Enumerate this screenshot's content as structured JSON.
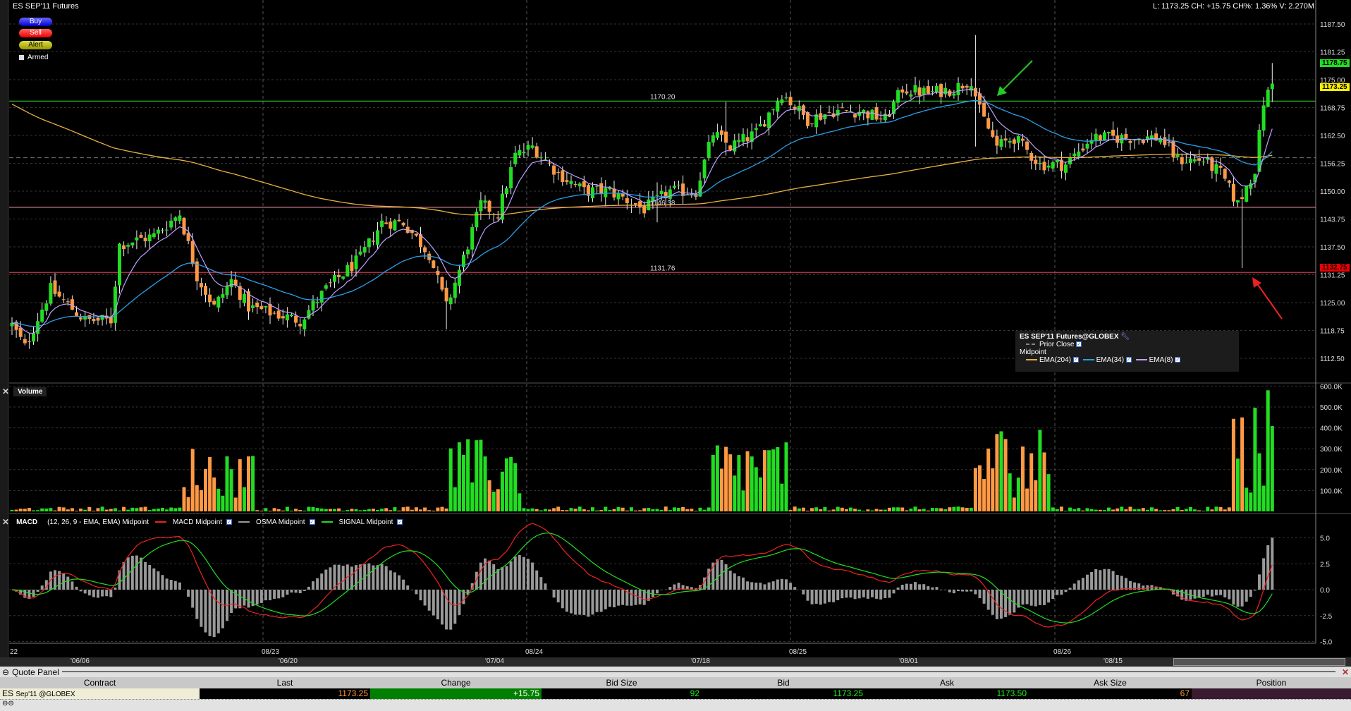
{
  "header": {
    "symbol": "ES SEP'11 Futures",
    "stats": "L: 1173.25 CH: +15.75 CH%: 1.36% V: 2.270M"
  },
  "buttons": {
    "buy": "Buy",
    "sell": "Sell",
    "alert": "Alert",
    "armed": "Armed"
  },
  "price_tags": {
    "high": "1178.75",
    "last": "1173.25",
    "low": "1132.75"
  },
  "hlines": [
    {
      "label": "1170.20",
      "value": 1170.2,
      "color": "#33cc33"
    },
    {
      "label": "1146.38",
      "value": 1146.38,
      "color": "#cc7788"
    },
    {
      "label": "1131.76",
      "value": 1131.76,
      "color": "#cc3344"
    }
  ],
  "prior_close": 1157.5,
  "legend": {
    "title": "ES SEP'11 Futures@GLOBEX",
    "prior_close": "Prior Close",
    "midpoint": "Midpoint",
    "ema204": "EMA(204)",
    "ema34": "EMA(34)",
    "ema8": "EMA(8)"
  },
  "colors": {
    "up": "#22dd22",
    "down": "#ff9944",
    "ema204": "#e8b040",
    "ema34": "#2a9fe8",
    "ema8": "#c0a0ff",
    "macd": "#ee2222",
    "signal": "#22dd22",
    "osma": "#999999"
  },
  "volume_panel": {
    "title": "Volume"
  },
  "macd_panel": {
    "title": "MACD",
    "params": "(12, 26, 9 - EMA, EMA) Midpoint",
    "macd": "MACD Midpoint",
    "osma": "OSMA Midpoint",
    "signal": "SIGNAL Midpoint"
  },
  "chart_data": {
    "type": "candlestick",
    "price_axis": {
      "ticks": [
        "1187.50",
        "1181.25",
        "1175.00",
        "1168.75",
        "1162.50",
        "1156.25",
        "1150.00",
        "1143.75",
        "1137.50",
        "1131.25",
        "1125.00",
        "1118.75",
        "1112.50"
      ],
      "range": [
        1106,
        1193
      ]
    },
    "volume_axis": {
      "ticks": [
        "600.0K",
        "500.0K",
        "400.0K",
        "300.0K",
        "200.0K",
        "100.0K"
      ],
      "range": [
        0,
        620
      ]
    },
    "macd_axis": {
      "ticks": [
        "5.0",
        "2.5",
        "0.0",
        "-2.5",
        "-5.0"
      ],
      "range": [
        -5,
        5
      ]
    },
    "date_labels": [
      "22",
      "08/23",
      "08/24",
      "08/25",
      "08/26"
    ],
    "scroll_labels": [
      "'06/06",
      "'06/20",
      "'07/04",
      "'07/18",
      "'08/01",
      "'08/15"
    ],
    "bars": 294,
    "anchors": [
      [
        0,
        1120
      ],
      [
        3,
        1115
      ],
      [
        9,
        1128
      ],
      [
        17,
        1121
      ],
      [
        23,
        1121
      ],
      [
        25,
        1138
      ],
      [
        33,
        1140
      ],
      [
        39,
        1145
      ],
      [
        43,
        1131
      ],
      [
        47,
        1124
      ],
      [
        51,
        1130
      ],
      [
        55,
        1124
      ],
      [
        63,
        1122
      ],
      [
        67,
        1121
      ],
      [
        73,
        1128
      ],
      [
        81,
        1135
      ],
      [
        86,
        1143
      ],
      [
        91,
        1143
      ],
      [
        97,
        1136
      ],
      [
        101,
        1124
      ],
      [
        105,
        1135
      ],
      [
        109,
        1147
      ],
      [
        113,
        1145
      ],
      [
        117,
        1158
      ],
      [
        121,
        1160
      ],
      [
        127,
        1154
      ],
      [
        133,
        1150
      ],
      [
        139,
        1150
      ],
      [
        147,
        1146
      ],
      [
        153,
        1150
      ],
      [
        159,
        1150
      ],
      [
        163,
        1163
      ],
      [
        167,
        1160
      ],
      [
        173,
        1163
      ],
      [
        179,
        1172
      ],
      [
        185,
        1166
      ],
      [
        191,
        1168
      ],
      [
        197,
        1168
      ],
      [
        203,
        1166
      ],
      [
        207,
        1173
      ],
      [
        213,
        1172
      ],
      [
        219,
        1173
      ],
      [
        223,
        1175
      ],
      [
        225,
        1168
      ],
      [
        229,
        1160
      ],
      [
        233,
        1162
      ],
      [
        239,
        1156
      ],
      [
        245,
        1156
      ],
      [
        251,
        1162
      ],
      [
        257,
        1162
      ],
      [
        263,
        1162
      ],
      [
        267,
        1162
      ],
      [
        271,
        1157
      ],
      [
        277,
        1157
      ],
      [
        281,
        1154
      ],
      [
        285,
        1147
      ],
      [
        289,
        1155
      ],
      [
        291,
        1170
      ],
      [
        293,
        1174
      ]
    ],
    "wicks": [
      [
        224,
        1185,
        1160
      ],
      [
        286,
        1150,
        1132.75
      ],
      [
        101,
        1130,
        1119
      ],
      [
        150,
        1152,
        1143
      ],
      [
        166,
        1170,
        1158
      ],
      [
        293,
        1178.75,
        1170
      ]
    ],
    "ema204_seed": 1170,
    "volume_clusters": [
      [
        40,
        56,
        320
      ],
      [
        102,
        118,
        350
      ],
      [
        163,
        180,
        360
      ],
      [
        224,
        241,
        420
      ],
      [
        284,
        294,
        580
      ]
    ]
  },
  "quote_panel": {
    "title": "Quote Panel",
    "columns": [
      "Contract",
      "Last",
      "Change",
      "Bid Size",
      "Bid",
      "Ask",
      "Ask Size",
      "Position"
    ],
    "row": {
      "contract": "ES",
      "contract_detail": "Sep'11 @GLOBEX",
      "last": "1173.25",
      "change": "+15.75",
      "bid_size": "92",
      "bid": "1173.25",
      "ask": "1173.50",
      "ask_size": "67",
      "position": ""
    }
  }
}
